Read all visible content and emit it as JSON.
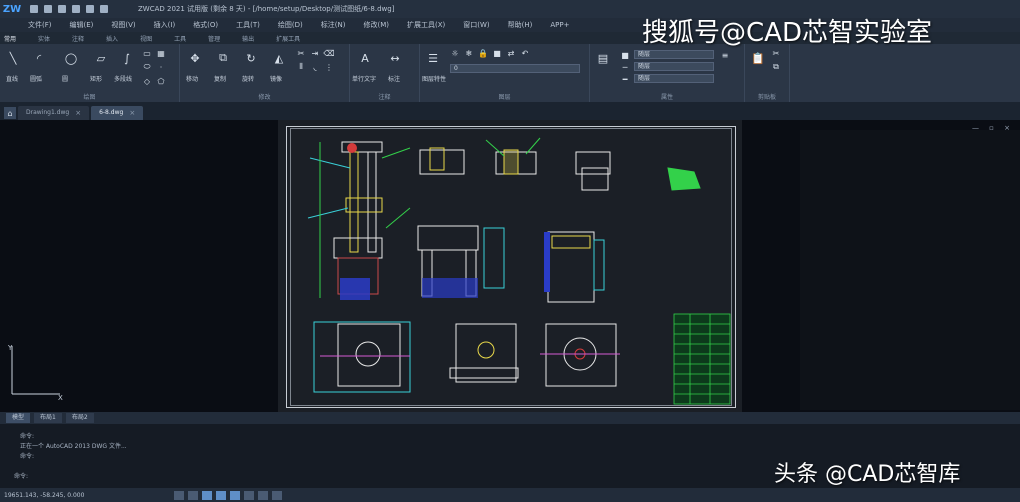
{
  "titlebar": {
    "title": "ZWCAD 2021 试用版 (剩余 8 天) - [/home/setup/Desktop/测试图纸/6-8.dwg]"
  },
  "menubar": {
    "items": [
      "文件(F)",
      "编辑(E)",
      "视图(V)",
      "插入(I)",
      "格式(O)",
      "工具(T)",
      "绘图(D)",
      "标注(N)",
      "修改(M)",
      "扩展工具(X)",
      "窗口(W)",
      "帮助(H)",
      "APP+"
    ]
  },
  "ribbon_tabs": {
    "items": [
      "常用",
      "实体",
      "注释",
      "插入",
      "视图",
      "工具",
      "管理",
      "输出",
      "扩展工具"
    ]
  },
  "ribbon": {
    "panels": [
      "绘图",
      "修改",
      "注释",
      "图层",
      "属性",
      "剪贴板"
    ],
    "draw_labels": [
      "直线",
      "圆弧",
      "圆",
      "矩形",
      "多段线"
    ],
    "modify_labels": [
      "移动",
      "复制",
      "旋转",
      "镜像"
    ],
    "annot_labels": [
      "单行文字",
      "标注"
    ],
    "layer_value": "0",
    "layer_label": "图层特性",
    "prop_bylayer": "随层",
    "prop_bylayer2": "随层",
    "prop_bylayer3": "随层"
  },
  "doctabs": {
    "items": [
      {
        "label": "Drawing1.dwg"
      },
      {
        "label": "6-8.dwg"
      }
    ]
  },
  "layout_tabs": {
    "items": [
      "模型",
      "布局1",
      "布局2"
    ]
  },
  "command": {
    "lines": [
      "命令:",
      "正在一个 AutoCAD 2013 DWG 文件...",
      "命令:"
    ],
    "prompt": "命令:"
  },
  "status": {
    "coords": "19651.143, -58.245, 0.000"
  },
  "watermarks": {
    "top": "搜狐号@CAD芯智实验室",
    "bottom": "头条 @CAD芯智库"
  },
  "colors": {
    "accent": "#4aa3ff",
    "cad_green": "#33d14a",
    "cad_yellow": "#e8d84a",
    "cad_magenta": "#d45bd4",
    "cad_blue": "#2a3cc8",
    "cad_cyan": "#3ad0d8"
  }
}
